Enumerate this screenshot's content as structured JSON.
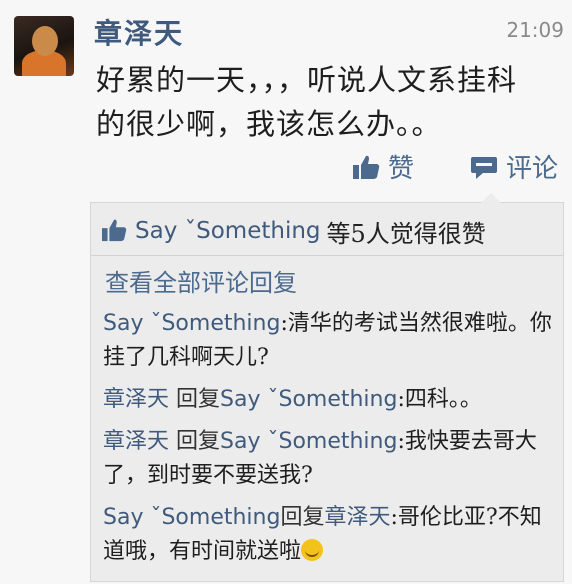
{
  "post": {
    "author": "章泽天",
    "time": "21:09",
    "text_line1": "好累的一天，，，听说人文系挂科",
    "text_line2": "的很少啊，我该怎么办。。"
  },
  "actions": {
    "like_label": "赞",
    "comment_label": "评论"
  },
  "likes": {
    "names": "Say ˇSomething",
    "suffix": "等5人觉得很赞"
  },
  "view_all_label": "查看全部评论回复",
  "comments": [
    {
      "name": "Say ˇSomething",
      "reply_word": "",
      "target": "",
      "text": ":清华的考试当然很难啦。你挂了几科啊天儿?"
    },
    {
      "name": "章泽天",
      "reply_word": " 回复",
      "target": "Say ˇSomething",
      "text": ":四科。。"
    },
    {
      "name": "章泽天",
      "reply_word": " 回复",
      "target": "Say ˇSomething",
      "text": ":我快要去哥大了，到时要不要送我?"
    },
    {
      "name": "Say ˇSomething",
      "reply_word": "回复",
      "target": "章泽天",
      "text": ":哥伦比亚?不知道哦，有时间就送啦"
    }
  ],
  "colors": {
    "name_blue": "#3f5a7c",
    "link_blue": "#4b6a8e",
    "emoji_yellow": "#f3c21b"
  },
  "icons": [
    "thumbs-up-icon",
    "comment-bubble-icon",
    "smile-emoji-icon"
  ]
}
